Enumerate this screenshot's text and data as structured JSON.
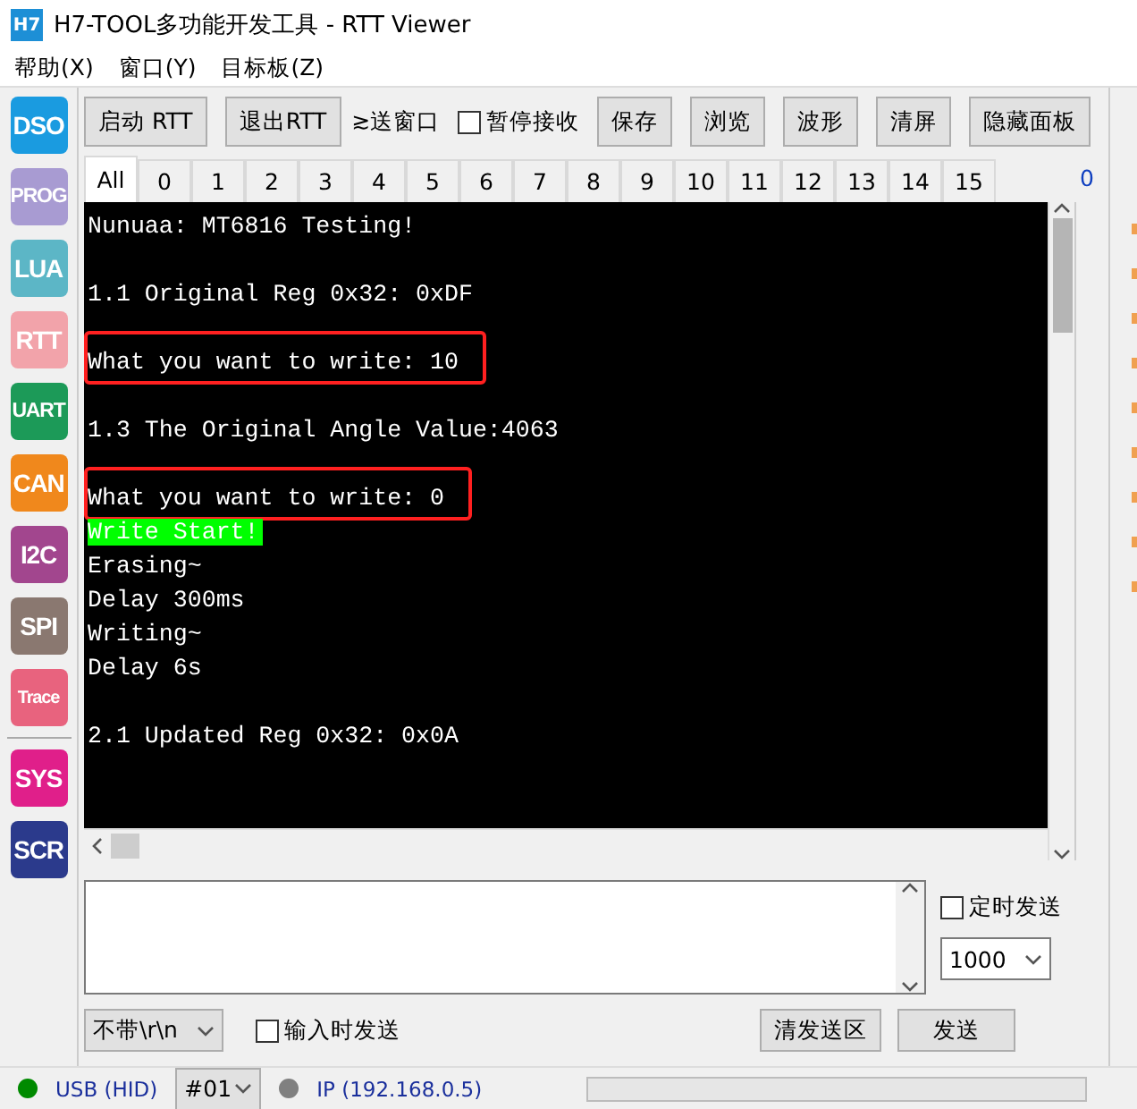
{
  "window": {
    "icon": "H7",
    "title": "H7-TOOL多功能开发工具 - RTT Viewer"
  },
  "menu": [
    "帮助(X)",
    "窗口(Y)",
    "目标板(Z)"
  ],
  "sidebar": [
    {
      "label": "DSO",
      "color": "#1a9be0"
    },
    {
      "label": "PROG",
      "color": "#a89bd2"
    },
    {
      "label": "LUA",
      "color": "#5cb6c6"
    },
    {
      "label": "RTT",
      "color": "#f2a3aa"
    },
    {
      "label": "UART",
      "color": "#1c9a58"
    },
    {
      "label": "CAN",
      "color": "#f0881c"
    },
    {
      "label": "I2C",
      "color": "#a2468e"
    },
    {
      "label": "SPI",
      "color": "#8a7870"
    },
    {
      "label": "Trace",
      "color": "#e8637e"
    },
    {
      "label": "SYS",
      "color": "#e01f8a",
      "group_break": true
    },
    {
      "label": "SCR",
      "color": "#2b3a8c"
    }
  ],
  "toolbar": [
    {
      "kind": "button",
      "label": "启动 RTT"
    },
    {
      "kind": "button",
      "label": "退出RTT"
    },
    {
      "kind": "label",
      "label": "≳送窗口"
    },
    {
      "kind": "checkbox",
      "label": "暂停接收",
      "checked": false
    },
    {
      "kind": "button",
      "label": "保存"
    },
    {
      "kind": "button",
      "label": "浏览"
    },
    {
      "kind": "button",
      "label": "波形"
    },
    {
      "kind": "button",
      "label": "清屏"
    },
    {
      "kind": "button",
      "label": "隐藏面板"
    }
  ],
  "tabs": [
    {
      "label": "All",
      "selected": true
    },
    {
      "label": "0",
      "selected": false
    },
    {
      "label": "1",
      "selected": false
    },
    {
      "label": "2",
      "selected": false
    },
    {
      "label": "3",
      "selected": false
    },
    {
      "label": "4",
      "selected": false
    },
    {
      "label": "5",
      "selected": false
    },
    {
      "label": "6",
      "selected": false
    },
    {
      "label": "7",
      "selected": false
    },
    {
      "label": "8",
      "selected": false
    },
    {
      "label": "9",
      "selected": false
    },
    {
      "label": "10",
      "selected": false
    },
    {
      "label": "11",
      "selected": false
    },
    {
      "label": "12",
      "selected": false
    },
    {
      "label": "13",
      "selected": false
    },
    {
      "label": "14",
      "selected": false
    },
    {
      "label": "15",
      "selected": false
    }
  ],
  "tab_count": "0",
  "terminal": [
    {
      "kind": "text",
      "text": "Nunuaa: MT6816 Testing!"
    },
    {
      "kind": "blank"
    },
    {
      "kind": "text",
      "text": "1.1 Original Reg 0x32: 0xDF"
    },
    {
      "kind": "blank"
    },
    {
      "kind": "boxed",
      "text": "What you want to write: 10"
    },
    {
      "kind": "blank"
    },
    {
      "kind": "text",
      "text": "1.3 The Original Angle Value:4063"
    },
    {
      "kind": "blank"
    },
    {
      "kind": "boxed",
      "text": "What you want to write: 0"
    },
    {
      "kind": "green",
      "text": "Write Start!"
    },
    {
      "kind": "text",
      "text": "Erasing~"
    },
    {
      "kind": "text",
      "text": "Delay 300ms"
    },
    {
      "kind": "text",
      "text": "Writing~"
    },
    {
      "kind": "text",
      "text": "Delay 6s"
    },
    {
      "kind": "blank"
    },
    {
      "kind": "text",
      "text": "2.1 Updated Reg 0x32: 0x0A"
    }
  ],
  "send": {
    "timed": {
      "label": "定时发送",
      "checked": false
    },
    "interval": "1000",
    "line_ending": "不带\\r\\n",
    "on_input": {
      "label": "输入时发送",
      "checked": false
    },
    "buttons": [
      "清发送区",
      "发送"
    ]
  },
  "status_bar": {
    "usb": {
      "label": "USB (HID)",
      "connected": true
    },
    "device": "#01",
    "ip": {
      "label": "IP (192.168.0.5)",
      "connected": false
    }
  }
}
